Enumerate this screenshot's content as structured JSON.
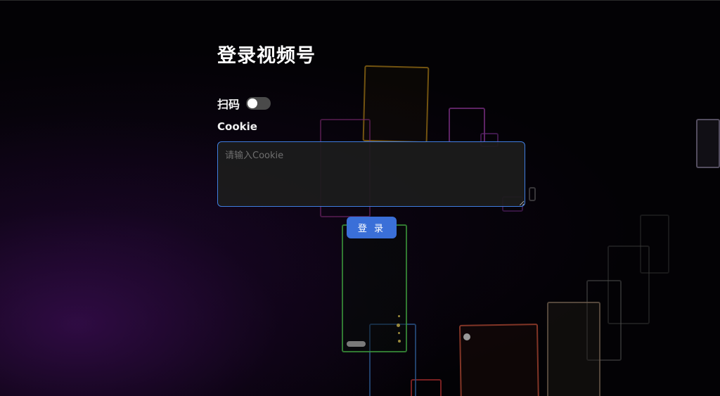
{
  "page": {
    "title": "登录视频号"
  },
  "form": {
    "scan_label": "扫码",
    "scan_enabled": false,
    "cookie_label": "Cookie",
    "cookie_placeholder": "请输入Cookie",
    "cookie_value": "",
    "login_label": "登 录"
  },
  "colors": {
    "accent": "#3a6fd8",
    "input_border": "#3f7de0",
    "background": "#030205"
  }
}
